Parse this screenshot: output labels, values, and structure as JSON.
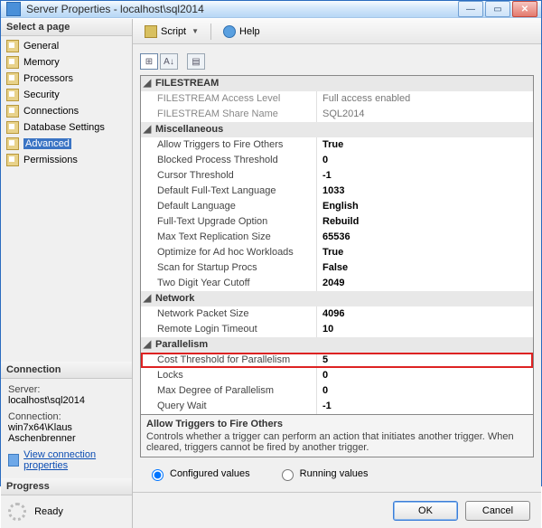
{
  "window": {
    "title": "Server Properties - localhost\\sql2014"
  },
  "winbtns": {
    "min": "—",
    "max": "▭",
    "close": "✕"
  },
  "sidebar": {
    "select_page": "Select a page",
    "pages": [
      {
        "label": "General"
      },
      {
        "label": "Memory"
      },
      {
        "label": "Processors"
      },
      {
        "label": "Security"
      },
      {
        "label": "Connections"
      },
      {
        "label": "Database Settings"
      },
      {
        "label": "Advanced",
        "selected": true
      },
      {
        "label": "Permissions"
      }
    ],
    "connection": {
      "header": "Connection",
      "server_label": "Server:",
      "server_value": "localhost\\sql2014",
      "conn_label": "Connection:",
      "conn_value": "win7x64\\Klaus Aschenbrenner",
      "view_link": "View connection properties"
    },
    "progress": {
      "header": "Progress",
      "status": "Ready"
    }
  },
  "toolbar": {
    "script": "Script",
    "help": "Help"
  },
  "gridtools": {
    "cat": "⊞",
    "az": "A↓",
    "pages": "▤"
  },
  "propgrid": {
    "categories": [
      {
        "name": "FILESTREAM",
        "rows": [
          {
            "name": "FILESTREAM Access Level",
            "value": "Full access enabled",
            "dim": true
          },
          {
            "name": "FILESTREAM Share Name",
            "value": "SQL2014",
            "dim": true
          }
        ]
      },
      {
        "name": "Miscellaneous",
        "rows": [
          {
            "name": "Allow Triggers to Fire Others",
            "value": "True"
          },
          {
            "name": "Blocked Process Threshold",
            "value": "0"
          },
          {
            "name": "Cursor Threshold",
            "value": "-1"
          },
          {
            "name": "Default Full-Text Language",
            "value": "1033"
          },
          {
            "name": "Default Language",
            "value": "English"
          },
          {
            "name": "Full-Text Upgrade Option",
            "value": "Rebuild"
          },
          {
            "name": "Max Text Replication Size",
            "value": "65536"
          },
          {
            "name": "Optimize for Ad hoc Workloads",
            "value": "True"
          },
          {
            "name": "Scan for Startup Procs",
            "value": "False"
          },
          {
            "name": "Two Digit Year Cutoff",
            "value": "2049"
          }
        ]
      },
      {
        "name": "Network",
        "rows": [
          {
            "name": "Network Packet Size",
            "value": "4096"
          },
          {
            "name": "Remote Login Timeout",
            "value": "10"
          }
        ]
      },
      {
        "name": "Parallelism",
        "rows": [
          {
            "name": "Cost Threshold for Parallelism",
            "value": "5",
            "highlight": true
          },
          {
            "name": "Locks",
            "value": "0"
          },
          {
            "name": "Max Degree of Parallelism",
            "value": "0"
          },
          {
            "name": "Query Wait",
            "value": "-1"
          }
        ]
      }
    ]
  },
  "desc": {
    "title": "Allow Triggers to Fire Others",
    "body": "Controls whether a trigger can perform an action that initiates another trigger. When cleared, triggers cannot be fired by another trigger."
  },
  "radios": {
    "configured": "Configured values",
    "running": "Running values"
  },
  "buttons": {
    "ok": "OK",
    "cancel": "Cancel"
  }
}
